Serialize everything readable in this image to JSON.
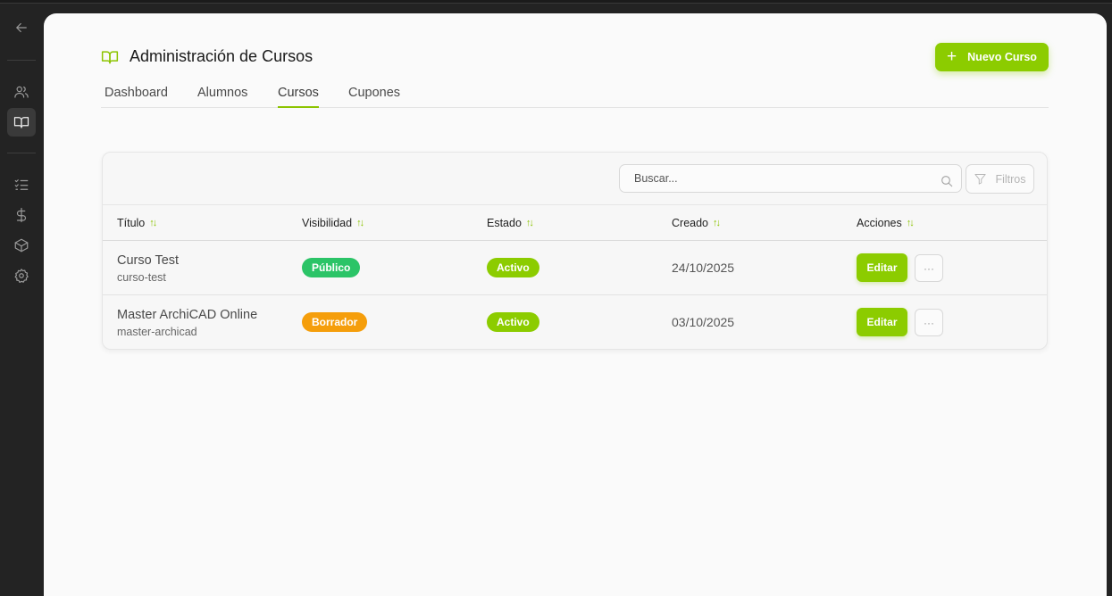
{
  "sidebar": {
    "items": [
      {
        "icon": "arrow-left-icon"
      },
      {
        "icon": "users-icon"
      },
      {
        "icon": "book-open-icon",
        "active": true
      },
      {
        "icon": "list-checks-icon"
      },
      {
        "icon": "dollar-icon"
      },
      {
        "icon": "package-icon"
      },
      {
        "icon": "gear-icon"
      }
    ]
  },
  "header": {
    "title": "Administración de Cursos",
    "new_button_label": "Nuevo Curso",
    "icon": "book-open-icon"
  },
  "tabs": [
    {
      "label": "Dashboard",
      "active": false
    },
    {
      "label": "Alumnos",
      "active": false
    },
    {
      "label": "Cursos",
      "active": true
    },
    {
      "label": "Cupones",
      "active": false
    }
  ],
  "toolbar": {
    "search_placeholder": "Buscar...",
    "filters_label": "Filtros"
  },
  "table": {
    "columns": [
      "Título",
      "Visibilidad",
      "Estado",
      "Creado",
      "Acciones"
    ],
    "rows": [
      {
        "title": "Curso Test",
        "slug": "curso-test",
        "visibility": "Público",
        "visibility_color": "#2bc467",
        "status": "Activo",
        "status_color": "#8ccc00",
        "created": "24/10/2025",
        "edit_label": "Editar",
        "more_label": "···"
      },
      {
        "title": "Master ArchiCAD Online",
        "slug": "master-archicad",
        "visibility": "Borrador",
        "visibility_color": "#f59e0b",
        "status": "Activo",
        "status_color": "#8ccc00",
        "created": "03/10/2025",
        "edit_label": "Editar",
        "more_label": "···"
      }
    ]
  },
  "colors": {
    "accent": "#8ccc00",
    "sidebar_bg": "#232323",
    "panel_bg": "#fafafa"
  }
}
